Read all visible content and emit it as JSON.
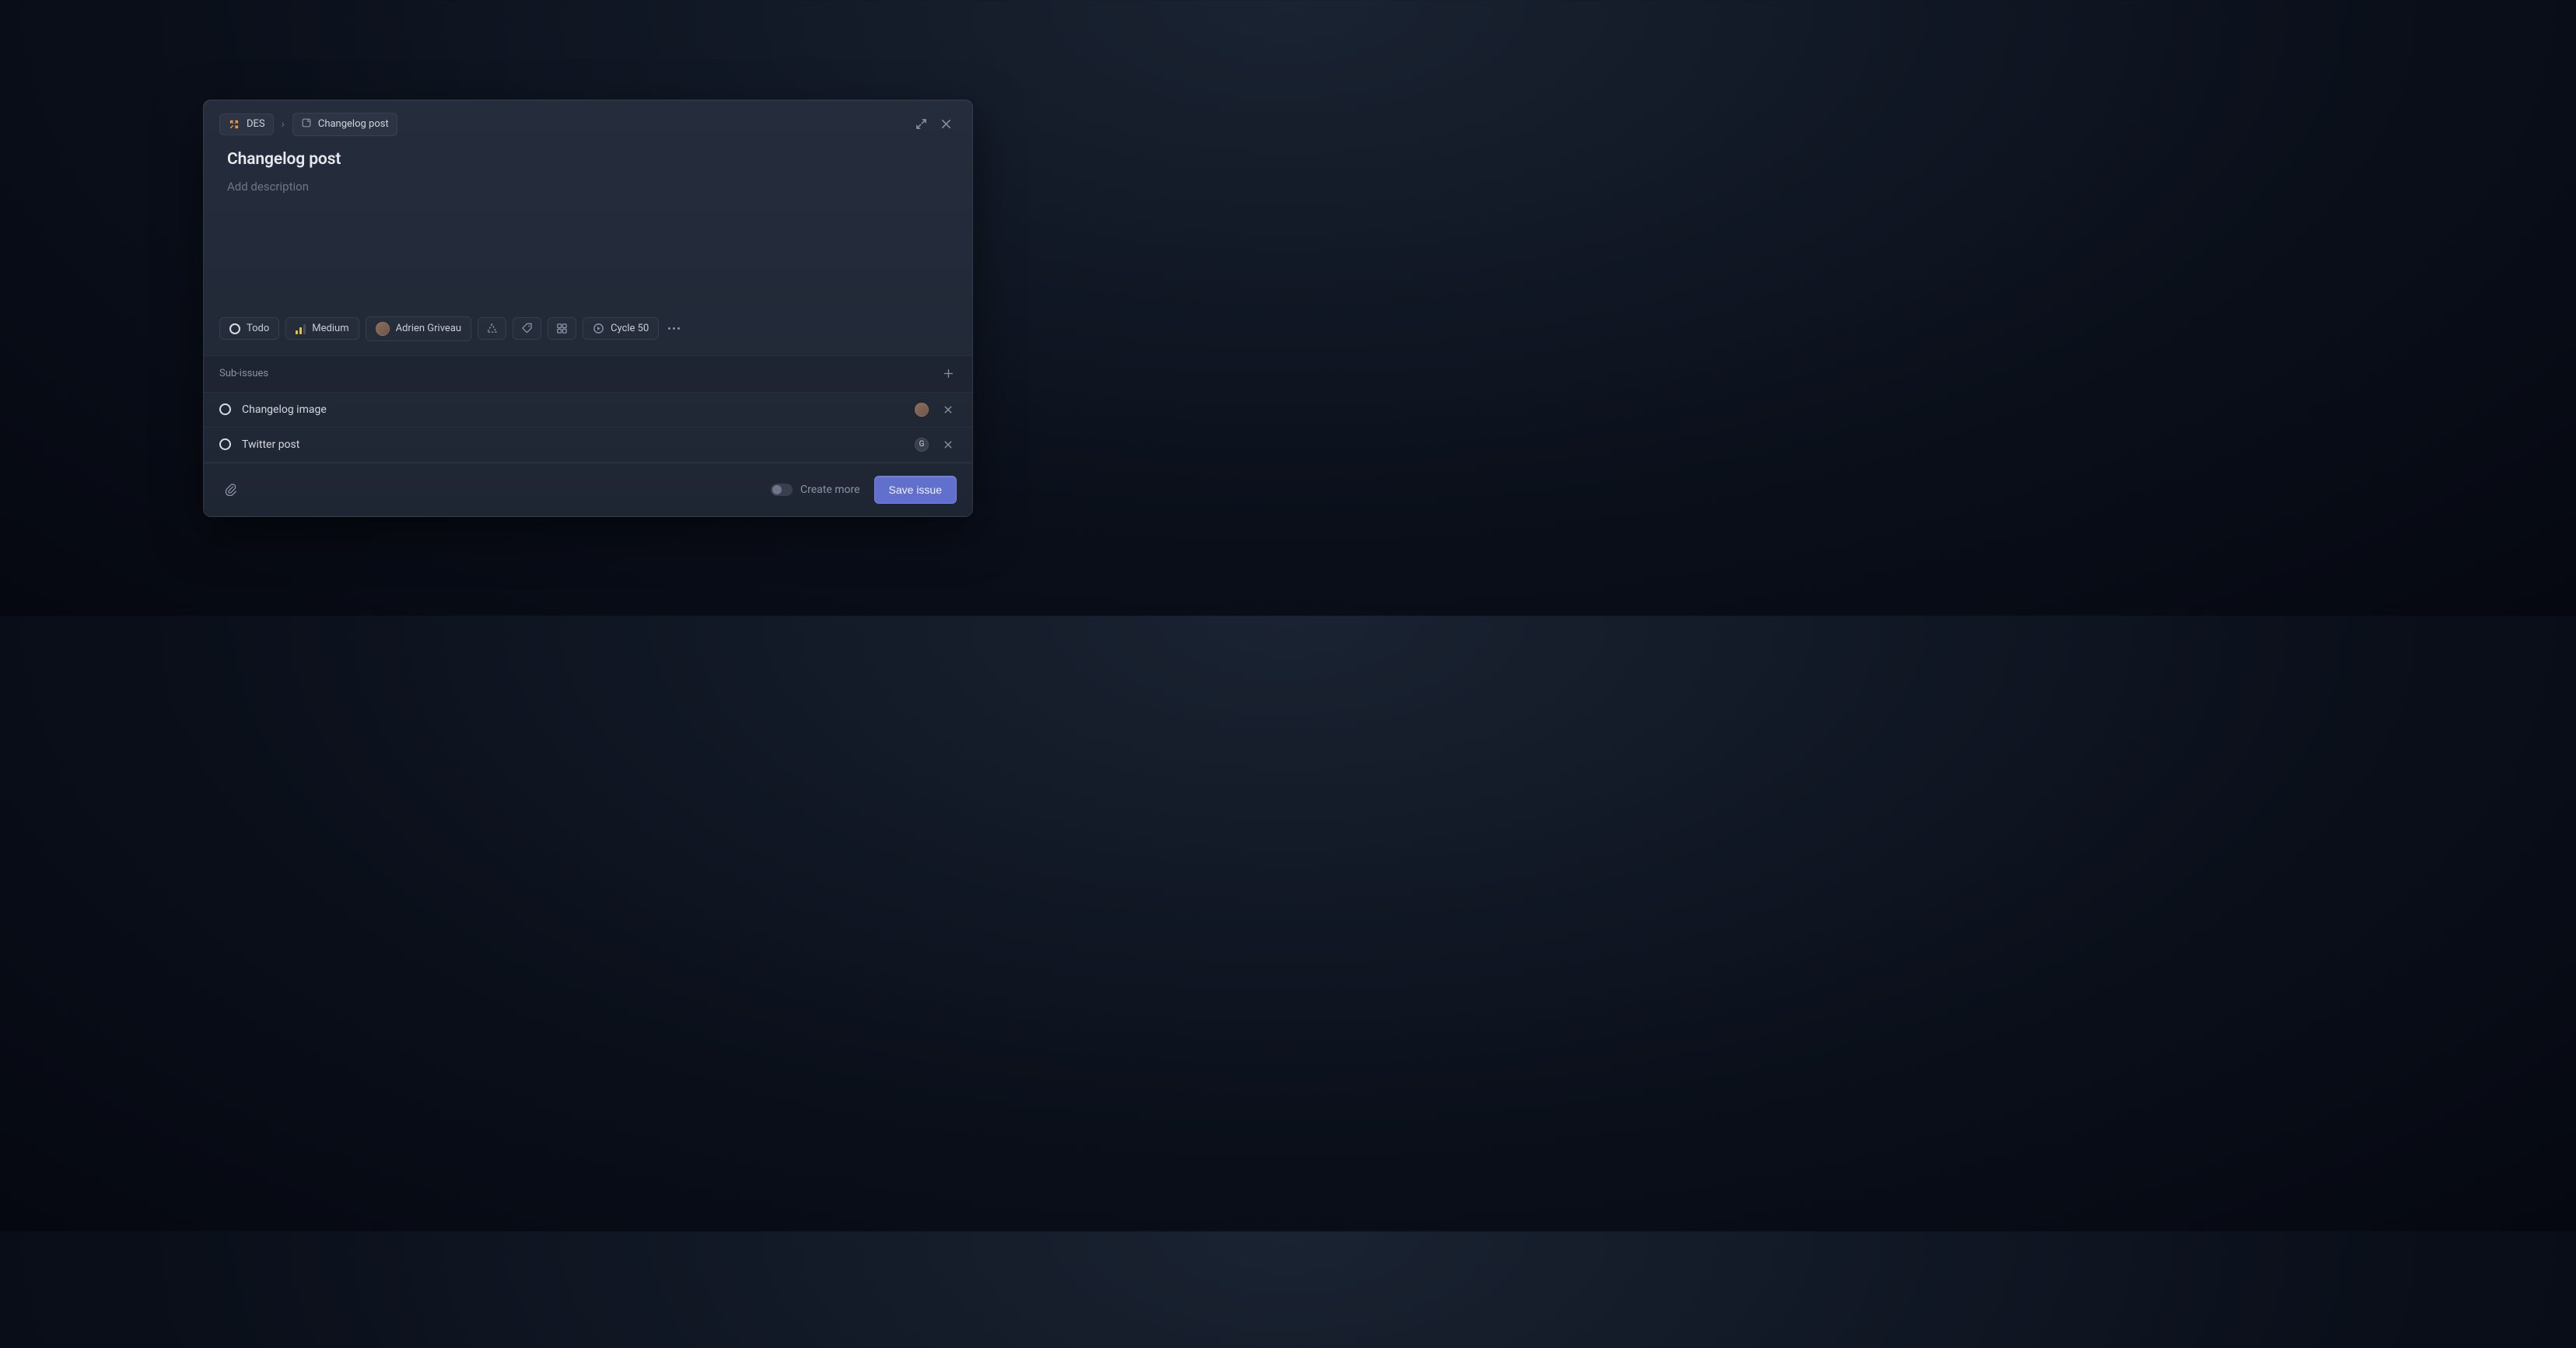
{
  "breadcrumbs": {
    "project_label": "DES",
    "separator": "›",
    "template_label": "Changelog post"
  },
  "issue": {
    "title": "Changelog post",
    "description_placeholder": "Add description"
  },
  "properties": {
    "status": "Todo",
    "priority": "Medium",
    "assignee": "Adrien Griveau",
    "cycle": "Cycle 50"
  },
  "sub_issues": {
    "heading": "Sub-issues",
    "items": [
      {
        "title": "Changelog image",
        "assignee": "Adrien Griveau"
      },
      {
        "title": "Twitter post",
        "assignee": "G"
      }
    ]
  },
  "footer": {
    "create_more_label": "Create more",
    "save_label": "Save issue"
  }
}
